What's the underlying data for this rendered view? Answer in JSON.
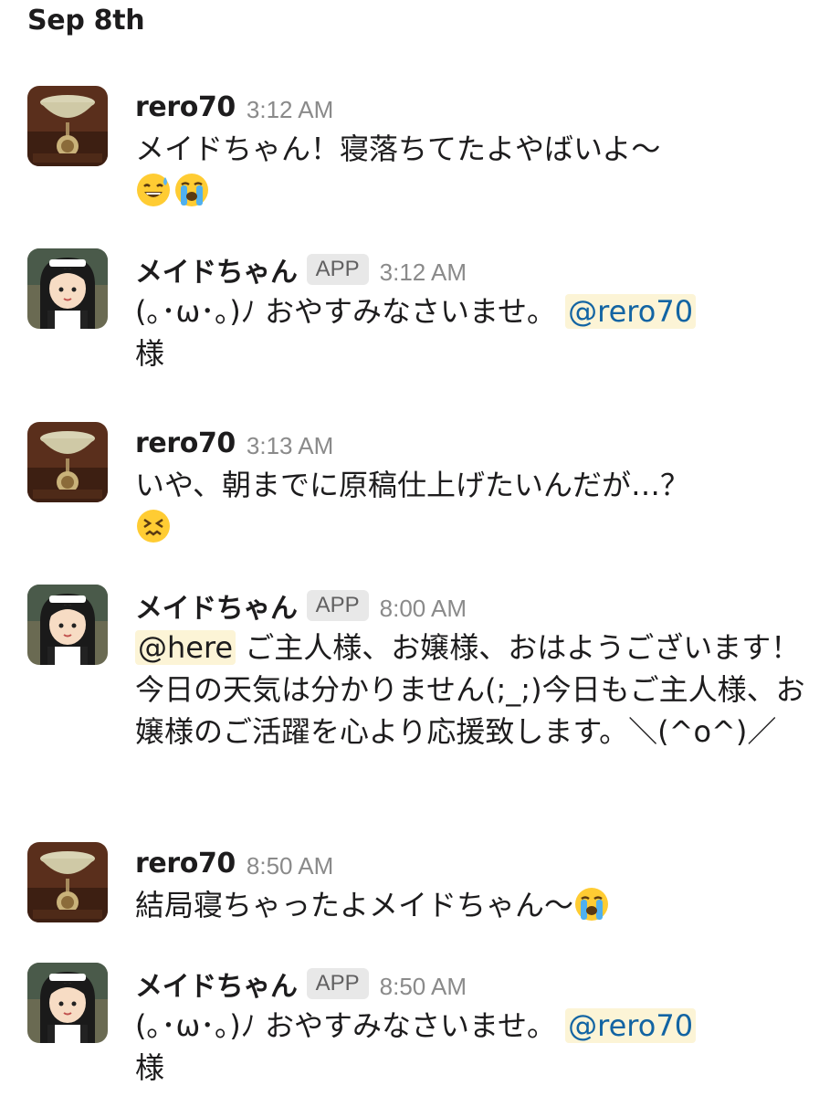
{
  "date_divider": "Sep 8th",
  "app_badge": "APP",
  "messages": [
    {
      "sender": "rero70",
      "time": "3:12 AM",
      "text": "メイドちゃん！寝落ちてたよやばいよ〜",
      "emojis": [
        "grinning-sweat-emoji",
        "loudly-crying-emoji"
      ]
    },
    {
      "sender": "メイドちゃん",
      "time": "3:12 AM",
      "text": "(｡･ω･｡)ﾉ おやすみなさいませ。",
      "mention": "@rero70",
      "suffix": "様"
    },
    {
      "sender": "rero70",
      "time": "3:13 AM",
      "text": "いや、朝までに原稿仕上げたいんだが…？",
      "emojis": [
        "confounded-face-emoji"
      ]
    },
    {
      "sender": "メイドちゃん",
      "time": "8:00 AM",
      "mention": "@here",
      "text": "ご主人様、お嬢様、おはようございます！今日の天気は分かりません(;_;)今日もご主人様、お嬢様のご活躍を心より応援致します。＼(^o^)／"
    },
    {
      "sender": "rero70",
      "time": "8:50 AM",
      "text": "結局寝ちゃったよメイドちゃん〜",
      "emojis": [
        "loudly-crying-emoji"
      ]
    },
    {
      "sender": "メイドちゃん",
      "time": "8:50 AM",
      "text": "(｡･ω･｡)ﾉ おやすみなさいませ。",
      "mention": "@rero70",
      "suffix": "様"
    }
  ]
}
